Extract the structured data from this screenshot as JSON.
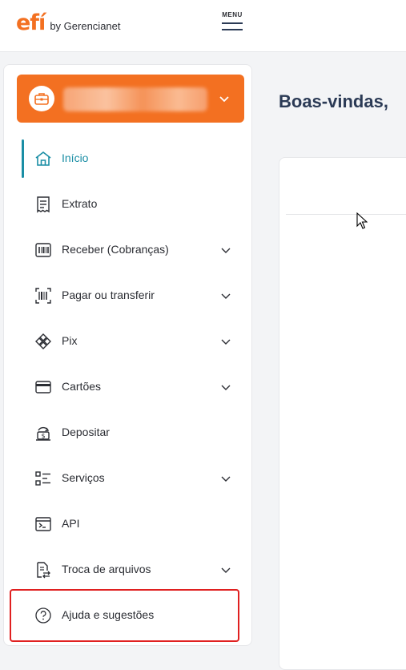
{
  "header": {
    "logo_mark": "efí",
    "logo_by": "by Gerencianet",
    "menu_label": "MENU"
  },
  "account": {
    "icon": "briefcase-icon"
  },
  "sidebar": {
    "items": [
      {
        "label": "Início",
        "icon": "home-icon",
        "active": true,
        "has_submenu": false
      },
      {
        "label": "Extrato",
        "icon": "receipt-icon",
        "active": false,
        "has_submenu": false
      },
      {
        "label": "Receber (Cobranças)",
        "icon": "invoice-icon",
        "active": false,
        "has_submenu": true
      },
      {
        "label": "Pagar ou transferir",
        "icon": "barcode-icon",
        "active": false,
        "has_submenu": true
      },
      {
        "label": "Pix",
        "icon": "pix-icon",
        "active": false,
        "has_submenu": true
      },
      {
        "label": "Cartões",
        "icon": "card-icon",
        "active": false,
        "has_submenu": true
      },
      {
        "label": "Depositar",
        "icon": "deposit-icon",
        "active": false,
        "has_submenu": false
      },
      {
        "label": "Serviços",
        "icon": "services-icon",
        "active": false,
        "has_submenu": true
      },
      {
        "label": "API",
        "icon": "terminal-icon",
        "active": false,
        "has_submenu": false
      },
      {
        "label": "Troca de arquivos",
        "icon": "file-exchange-icon",
        "active": false,
        "has_submenu": true
      },
      {
        "label": "Ajuda e sugestões",
        "icon": "help-icon",
        "active": false,
        "has_submenu": false
      }
    ]
  },
  "main": {
    "welcome": "Boas-vindas,"
  },
  "colors": {
    "brand_orange": "#f37021",
    "active_teal": "#1a8ea5",
    "highlight_red": "#e02020"
  }
}
